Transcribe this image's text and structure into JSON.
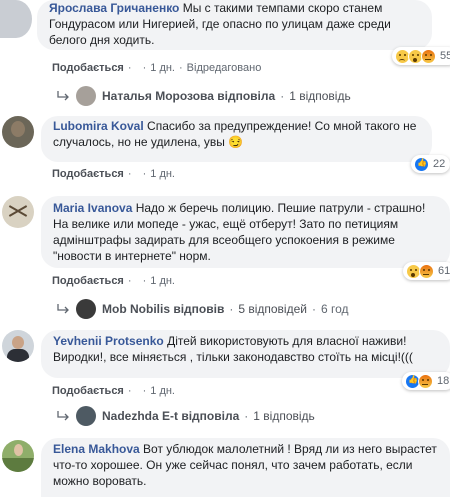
{
  "comments": [
    {
      "author": "Ярослава Гричаненко",
      "text": "Мы с такими темпами скоро станем Гондурасом или Нигерией, где опасно по улицам даже среди белого дня ходить.",
      "like": "Подобається",
      "time": "1 дн.",
      "edited": "Відредаговано",
      "reaction_count": "55",
      "reactions": [
        "sad",
        "wow",
        "angry"
      ]
    },
    {
      "author": "Lubomira Koval",
      "text": "Спасибо за предупреждение! Со мной такого не случалось, но не удилена, увы 😏",
      "like": "Подобається",
      "time": "1 дн.",
      "reaction_count": "22",
      "reactions": [
        "like"
      ]
    },
    {
      "author": "Maria Ivanova",
      "text": "Надо ж беречь полицию. Пешие патрули - страшно! На велике или мопеде - ужас, ещё отберут! Зато по петициям адмінштрафы задирать для всеобщего успокоения в режиме \"новости в интернете\" норм.",
      "like": "Подобається",
      "time": "1 дн.",
      "reaction_count": "61",
      "reactions": [
        "wow",
        "angry"
      ]
    },
    {
      "author": "Yevhenii Protsenko",
      "text": "Дітей використовують для власної наживи! Виродки!, все міняється , тільки законодавство стоїть на місці!(((",
      "like": "Подобається",
      "time": "1 дн.",
      "reaction_count": "18",
      "reactions": [
        "like",
        "angry"
      ]
    },
    {
      "author": "Elena Makhova",
      "text": "Вот ублюдок малолетний ! Вряд ли из него вырастет что-то хорошее. Он уже сейчас понял, что зачем работать, если можно воровать."
    }
  ],
  "replies": [
    {
      "name": "Наталья Морозова відповіла",
      "count": "1 відповідь"
    },
    {
      "name": "Mob Nobilis відповів",
      "count": "5 відповідей",
      "time": "6 год"
    },
    {
      "name": "Nadezhda E-t відповіла",
      "count": "1 відповідь"
    }
  ],
  "colors": {
    "link": "#385898",
    "bubble": "#f2f3f5",
    "like_blue": "#1877f2"
  }
}
